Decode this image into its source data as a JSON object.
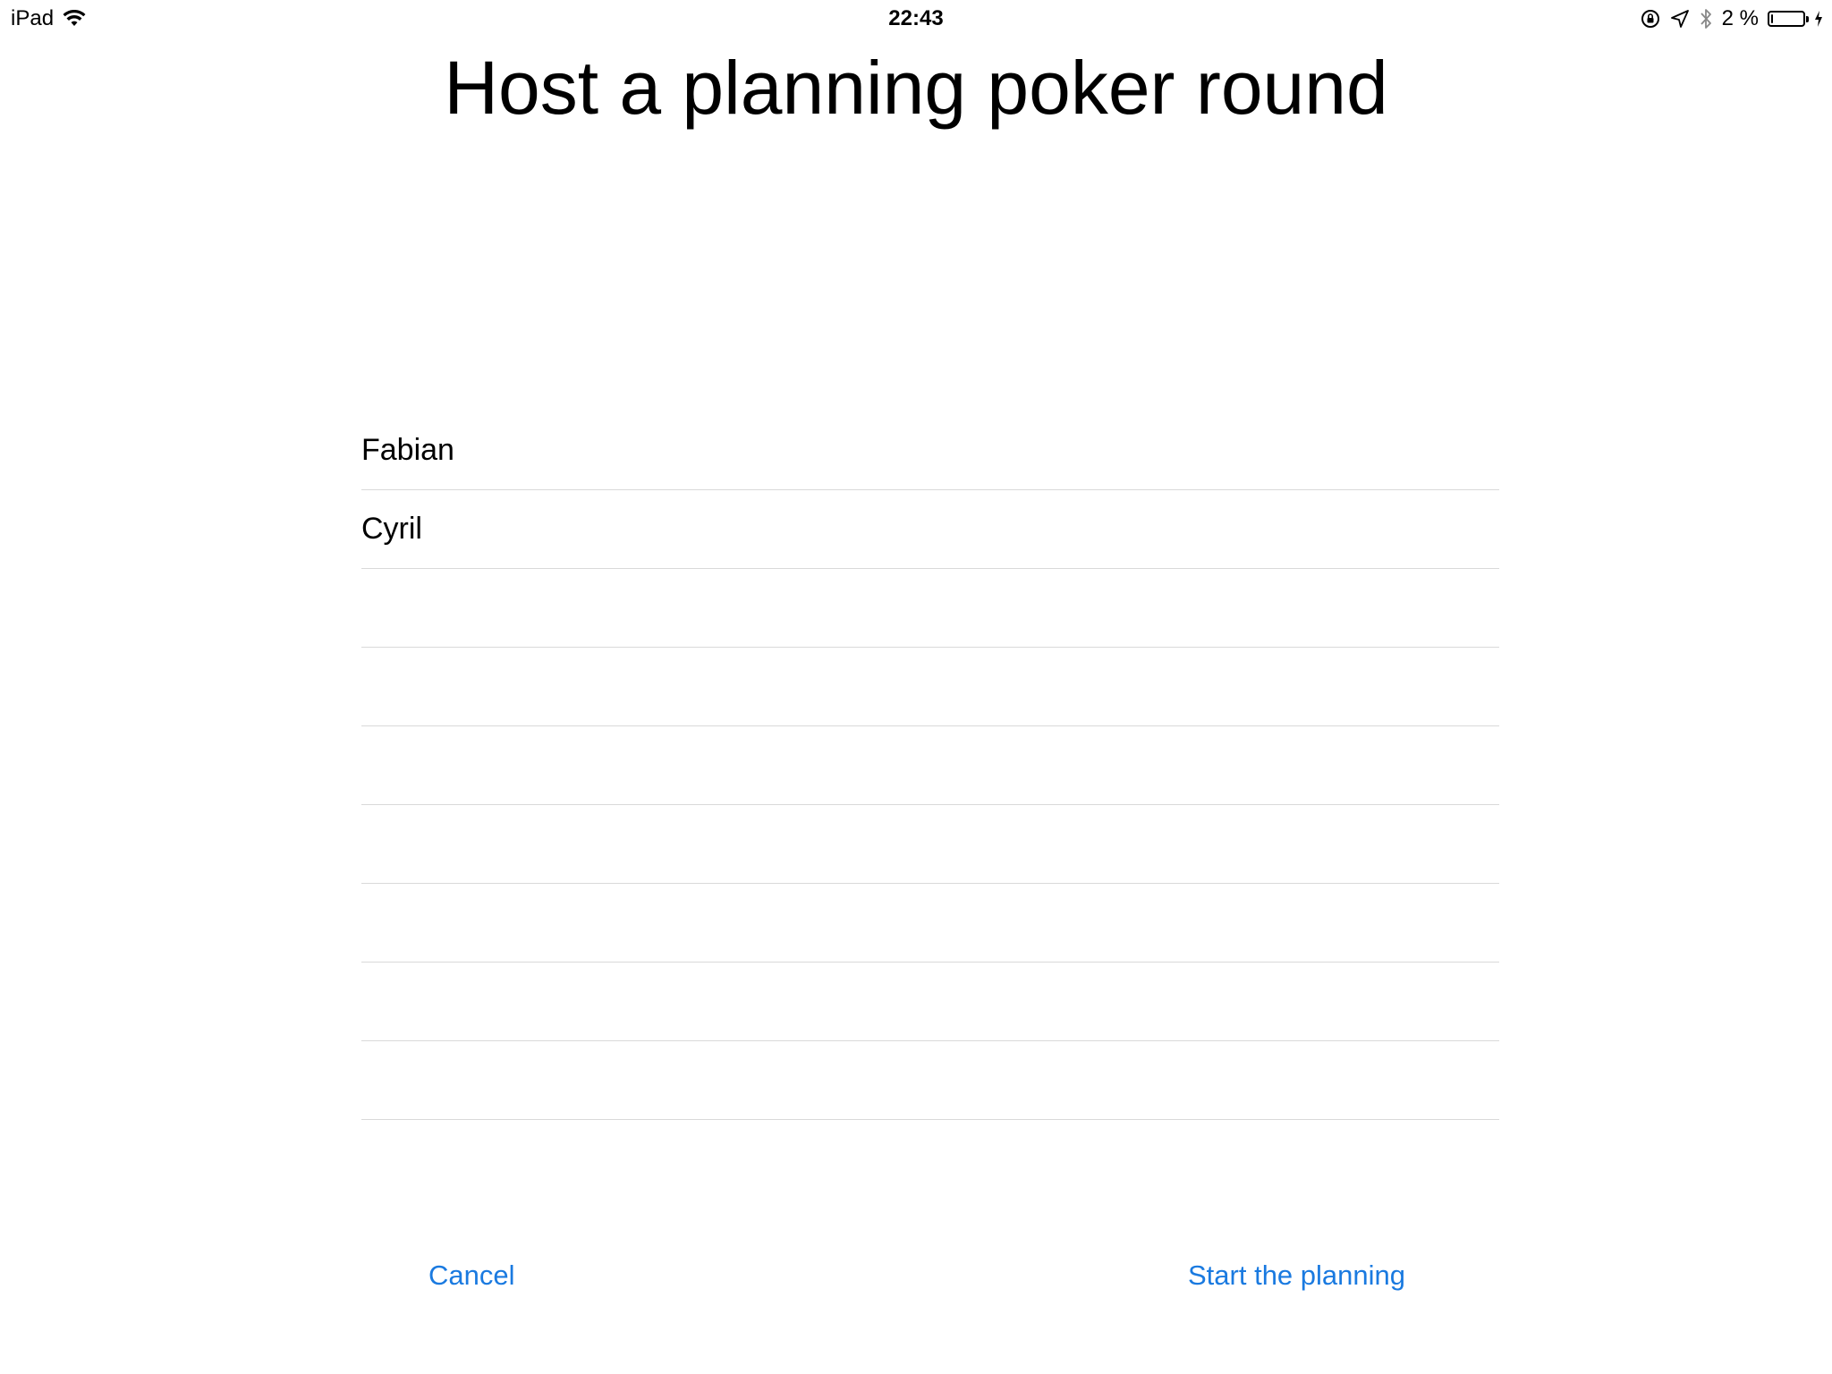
{
  "status_bar": {
    "device": "iPad",
    "time": "22:43",
    "battery_percent": "2 %",
    "battery_level": 0.02
  },
  "title": "Host a planning poker round",
  "participants": [
    "Fabian",
    "Cyril",
    "",
    "",
    "",
    "",
    "",
    "",
    ""
  ],
  "buttons": {
    "cancel": "Cancel",
    "start": "Start the planning"
  },
  "colors": {
    "accent": "#1a7ae0",
    "separator": "#d9d9d9"
  }
}
